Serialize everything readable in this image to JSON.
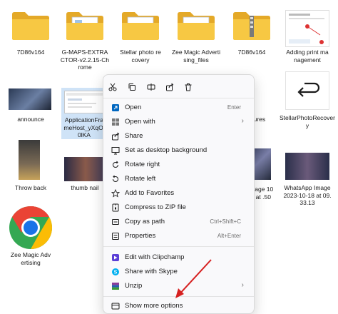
{
  "row1": [
    {
      "label": "7D86v164",
      "kind": "folder"
    },
    {
      "label": "G-MAPS-EXTRACTOR-v2.2.15-Chrome",
      "kind": "folder"
    },
    {
      "label": "Stellar photo recovery",
      "kind": "folder"
    },
    {
      "label": "Zee Magic Advertising_files",
      "kind": "folder"
    },
    {
      "label": "7D86v164",
      "kind": "zip-folder"
    },
    {
      "label": "Adding print management",
      "kind": "image"
    }
  ],
  "row2": [
    {
      "label": "announce"
    },
    {
      "label": "ApplicationFrameHost_yXqOl0lKA"
    },
    {
      "label": "eatures"
    },
    {
      "label": "StellarPhotoRecovery"
    }
  ],
  "row3": [
    {
      "label": "Throw back"
    },
    {
      "label": "thumb nail"
    },
    {
      "label": "p Image 10-18 at .50"
    },
    {
      "label": "WhatsApp Image 2023-10-18 at 09.33.13"
    }
  ],
  "row4": [
    {
      "label": "Zee Magic Advertising"
    }
  ],
  "context_menu": {
    "top_icons": [
      "cut-icon",
      "copy-icon",
      "rename-icon",
      "share-icon",
      "delete-icon"
    ],
    "items": [
      {
        "label": "Open",
        "shortcut": "Enter",
        "icon": "open-icon"
      },
      {
        "label": "Open with",
        "shortcut": "",
        "icon": "open-with-icon",
        "submenu": true
      },
      {
        "label": "Share",
        "shortcut": "",
        "icon": "share-icon"
      },
      {
        "label": "Set as desktop background",
        "shortcut": "",
        "icon": "wallpaper-icon"
      },
      {
        "label": "Rotate right",
        "shortcut": "",
        "icon": "rotate-right-icon"
      },
      {
        "label": "Rotate left",
        "shortcut": "",
        "icon": "rotate-left-icon"
      },
      {
        "label": "Add to Favorites",
        "shortcut": "",
        "icon": "star-icon"
      },
      {
        "label": "Compress to ZIP file",
        "shortcut": "",
        "icon": "zip-icon"
      },
      {
        "label": "Copy as path",
        "shortcut": "Ctrl+Shift+C",
        "icon": "path-icon"
      },
      {
        "label": "Properties",
        "shortcut": "Alt+Enter",
        "icon": "properties-icon"
      },
      {
        "label": "Edit with Clipchamp",
        "shortcut": "",
        "icon": "clipchamp-icon"
      },
      {
        "label": "Share with Skype",
        "shortcut": "",
        "icon": "skype-icon"
      },
      {
        "label": "Unzip",
        "shortcut": "",
        "icon": "winrar-icon",
        "submenu": true
      },
      {
        "label": "Show more options",
        "shortcut": "",
        "icon": "more-options-icon"
      }
    ],
    "submenu_chevron": "›"
  },
  "colors": {
    "folder": "#f7c843",
    "folder_dark": "#e4a928",
    "accent": "#0067c0",
    "arrow": "#d62020"
  }
}
